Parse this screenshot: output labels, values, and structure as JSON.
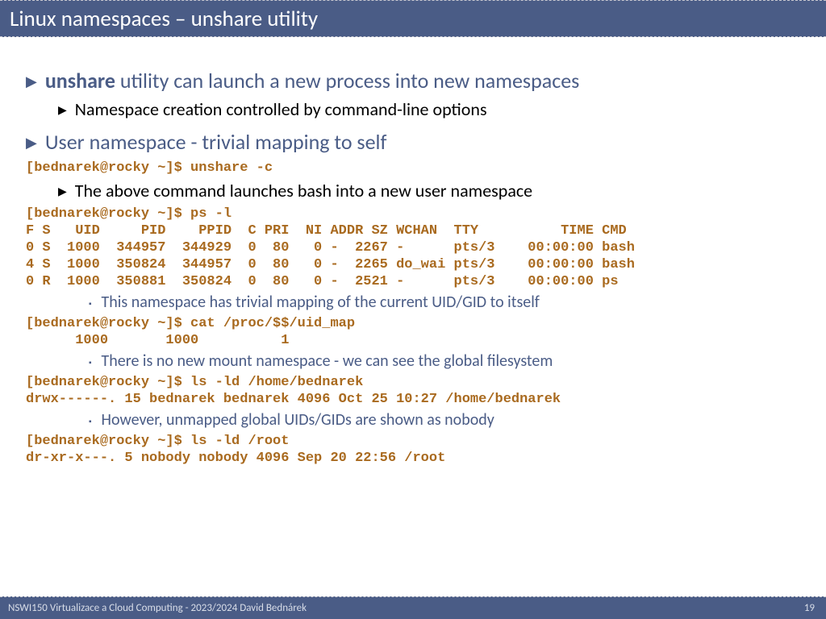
{
  "title": "Linux namespaces – unshare utility",
  "b1_bold": "unshare",
  "b1_rest": " utility can launch a new process into new namespaces",
  "b1_1": "Namespace creation controlled by command-line options",
  "b2": "User namespace - trivial mapping to self",
  "code1": "[bednarek@rocky ~]$ unshare -c",
  "b2_1": "The above command launches bash into a new user namespace",
  "code2": "[bednarek@rocky ~]$ ps -l\nF S   UID     PID    PPID  C PRI  NI ADDR SZ WCHAN  TTY          TIME CMD\n0 S  1000  344957  344929  0  80   0 -  2267 -      pts/3    00:00:00 bash\n4 S  1000  350824  344957  0  80   0 -  2265 do_wai pts/3    00:00:00 bash\n0 R  1000  350881  350824  0  80   0 -  2521 -      pts/3    00:00:00 ps",
  "b2_2": "This namespace has trivial mapping of the current UID/GID to itself",
  "code3": "[bednarek@rocky ~]$ cat /proc/$$/uid_map\n      1000       1000          1",
  "b2_3": "There is no new mount namespace - we can see the global filesystem",
  "code4": "[bednarek@rocky ~]$ ls -ld /home/bednarek\ndrwx------. 15 bednarek bednarek 4096 Oct 25 10:27 /home/bednarek",
  "b2_4": "However, unmapped global UIDs/GIDs are shown as nobody",
  "code5": "[bednarek@rocky ~]$ ls -ld /root\ndr-xr-x---. 5 nobody nobody 4096 Sep 20 22:56 /root",
  "footer_left": "NSWI150 Virtualizace a Cloud Computing - 2023/2024 David Bednárek",
  "footer_right": "19"
}
